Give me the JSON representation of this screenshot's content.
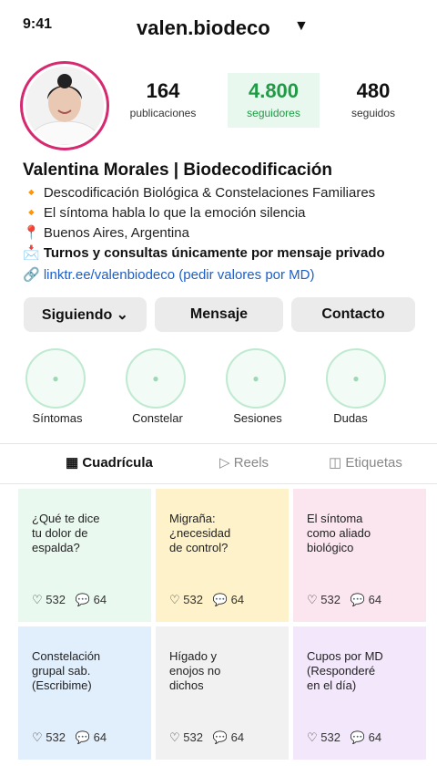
{
  "status": {
    "time": "9:41"
  },
  "header": {
    "username": "valen.biodeco",
    "caret": "▼"
  },
  "stats": [
    {
      "num": "164",
      "label": "publicaciones"
    },
    {
      "num": "4.800",
      "label": "seguidores"
    },
    {
      "num": "480",
      "label": "seguidos"
    }
  ],
  "profile": {
    "name": "Valentina Morales | Biodecodificación",
    "bio": [
      "🔸 Descodificación Biológica & Constelaciones Familiares",
      "🔸 El síntoma habla lo que la emoción silencia",
      "📍 Buenos Aires, Argentina",
      "📩 Turnos y consultas únicamente por mensaje privado",
      "🔗 linktr.ee/valenbiodeco (pedir valores por MD)"
    ]
  },
  "buttons": {
    "following": "Siguiendo ⌄",
    "message": "Mensaje",
    "contact": "Contacto"
  },
  "highlights": [
    {
      "label": "Síntomas",
      "icon": "●"
    },
    {
      "label": "Constelar",
      "icon": "●"
    },
    {
      "label": "Sesiones",
      "icon": "●"
    },
    {
      "label": "Dudas",
      "icon": "●"
    }
  ],
  "tabs": [
    {
      "label": "▦ Cuadrícula"
    },
    {
      "label": "▷ Reels"
    },
    {
      "label": "◫ Etiquetas"
    }
  ],
  "posts": [
    {
      "title": "¿Qué te dice\ntu dolor de\nespalda?",
      "stats": "♡ 532   💬 64",
      "bg": "#e9f9ef"
    },
    {
      "title": "Migraña:\n¿necesidad\nde control?",
      "stats": "♡ 532   💬 64",
      "bg": "#fdf2c9"
    },
    {
      "title": "El síntoma\ncomo aliado\nbiológico",
      "stats": "♡ 532   💬 64",
      "bg": "#fbe5ef"
    },
    {
      "title": "Constelación\ngrupal sab.\n(Escribime)",
      "stats": "♡ 532   💬 64",
      "bg": "#e1eefb"
    },
    {
      "title": "Hígado y\nenojos no\ndichos",
      "stats": "♡ 532   💬 64",
      "bg": "#f1f1f1"
    },
    {
      "title": "Cupos por MD\n(Responderé\nen el día)",
      "stats": "♡ 532   💬 64",
      "bg": "#f3e7fb"
    }
  ]
}
